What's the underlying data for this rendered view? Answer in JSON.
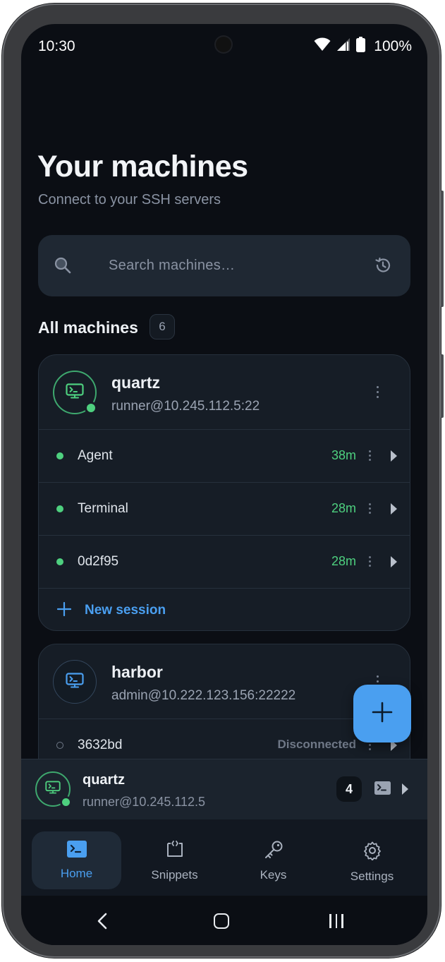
{
  "status_bar": {
    "time": "10:30",
    "battery": "100%",
    "icons": [
      "wifi-icon",
      "signal-icon",
      "battery-icon"
    ]
  },
  "header": {
    "title": "Your machines",
    "subtitle": "Connect to your SSH servers"
  },
  "search": {
    "placeholder": "Search machines…",
    "icons": [
      "search-icon",
      "history-icon"
    ]
  },
  "section": {
    "title": "All machines",
    "count": "6"
  },
  "machines": [
    {
      "name": "quartz",
      "address": "runner@10.245.112.5:22",
      "online": true,
      "sessions": [
        {
          "name": "Agent",
          "time": "38m",
          "connected": true
        },
        {
          "name": "Terminal",
          "time": "28m",
          "connected": true
        },
        {
          "name": "0d2f95",
          "time": "28m",
          "connected": true
        }
      ],
      "new_session_label": "New session"
    },
    {
      "name": "harbor",
      "address": "admin@10.222.123.156:22222",
      "online": false,
      "sessions": [
        {
          "name": "3632bd",
          "status": "Disconnected",
          "connected": false
        }
      ]
    }
  ],
  "active_connection": {
    "name": "quartz",
    "address": "runner@10.245.112.5",
    "session_count": "4"
  },
  "bottom_nav": {
    "items": [
      {
        "label": "Home",
        "icon": "terminal-icon",
        "active": true
      },
      {
        "label": "Snippets",
        "icon": "snippet-icon",
        "active": false
      },
      {
        "label": "Keys",
        "icon": "key-icon",
        "active": false
      },
      {
        "label": "Settings",
        "icon": "gear-icon",
        "active": false
      }
    ]
  },
  "colors": {
    "background": "#0b0e14",
    "card": "#161d26",
    "accent": "#4a9ff0",
    "online": "#4ed07f"
  }
}
